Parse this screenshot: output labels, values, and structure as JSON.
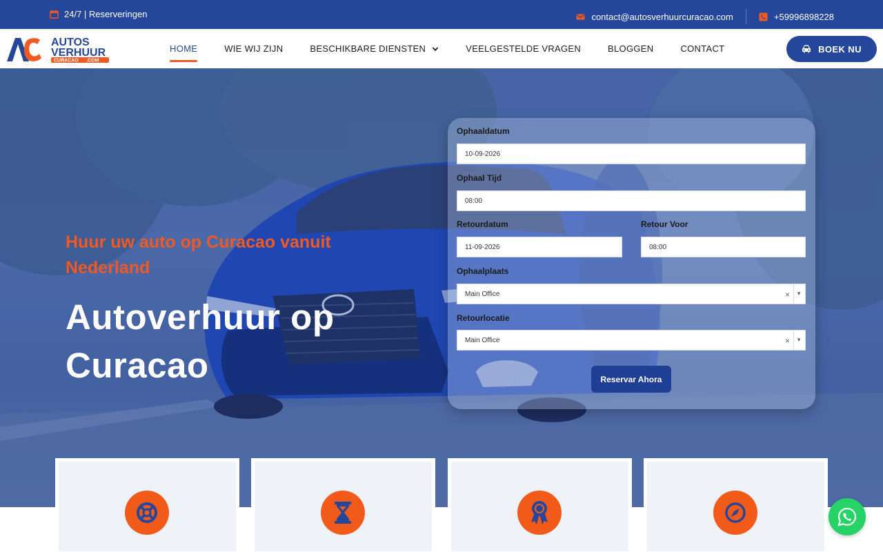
{
  "topbar": {
    "hours": "24/7 | Reserveringen",
    "email": "contact@autosverhuurcuracao.com",
    "phone": "+59996898228"
  },
  "logo": {
    "line1": "AUTOS",
    "line2": "VERHUUR",
    "line3": "CURACAO",
    "tld": ".COM",
    "mark": "AVC"
  },
  "nav": {
    "items": [
      "HOME",
      "WIE WIJ ZIJN",
      "BESCHIKBARE DIENSTEN",
      "VEELGESTELDE VRAGEN",
      "BLOGGEN",
      "CONTACT"
    ],
    "active": "HOME",
    "book_label": "BOEK NU"
  },
  "hero": {
    "subtitle": "Huur uw auto op Curacao vanuit Nederland",
    "title": "Autoverhuur op Curacao"
  },
  "form": {
    "pickup_date_label": "Ophaaldatum",
    "pickup_date_value": "10-09-2026",
    "pickup_time_label": "Ophaal Tijd",
    "pickup_time_value": "08:00",
    "return_date_label": "Retourdatum",
    "return_date_value": "11-09-2026",
    "return_time_label": "Retour Voor",
    "return_time_value": "08:00",
    "pickup_place_label": "Ophaalplaats",
    "pickup_place_value": "Main Office",
    "return_place_label": "Retourlocatie",
    "return_place_value": "Main Office",
    "submit_label": "Reservar Ahora"
  },
  "features": [
    {
      "icon": "lifebuoy-icon"
    },
    {
      "icon": "hourglass-icon"
    },
    {
      "icon": "award-ribbon-icon"
    },
    {
      "icon": "compass-icon"
    }
  ],
  "colors": {
    "primary": "#24479b",
    "accent": "#f05a22",
    "whatsapp": "#25d366"
  }
}
